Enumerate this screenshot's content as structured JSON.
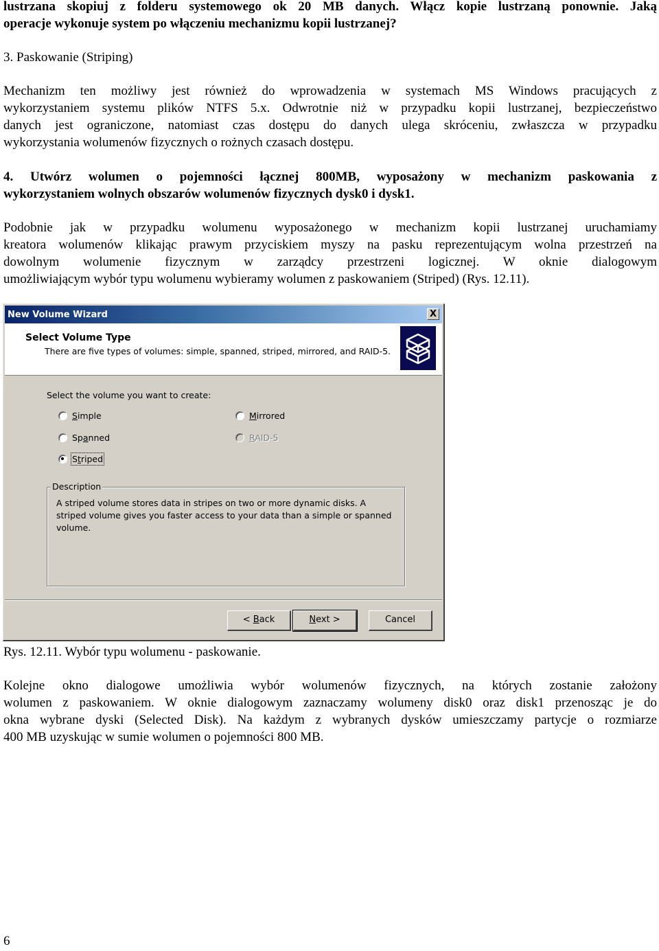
{
  "document": {
    "intro_question": {
      "lines": [
        "lustrzana skopiuj z folderu systemowego ok 20 MB danych. Włącz kopie lustrzaną ponownie. Jaką",
        "operacje wykonuje system po włączeniu mechanizmu kopii lustrzanej?"
      ]
    },
    "section_heading": "3. Paskowanie (Striping)",
    "paragraph_striping": {
      "lines": [
        "Mechanizm ten możliwy jest również do wprowadzenia w systemach MS Windows pracujących z",
        "wykorzystaniem systemu plików NTFS 5.x. Odwrotnie niż w przypadku kopii lustrzanej, bezpieczeństwo",
        "danych jest ograniczone, natomiast czas dostępu do danych ulega skróceniu, zwłaszcza w przypadku",
        "wykorzystania wolumenów fizycznych o rożnych czasach dostępu."
      ]
    },
    "task_4": {
      "lines": [
        "4. Utwórz wolumen o pojemności łącznej 800MB, wyposażony w mechanizm paskowania z",
        "wykorzystaniem wolnych obszarów wolumenów fizycznych dysk0 i dysk1."
      ]
    },
    "paragraph_wizard": {
      "lines": [
        "Podobnie jak w przypadku wolumenu wyposażonego w mechanizm kopii lustrzanej uruchamiamy",
        "kreatora wolumenów klikając prawym przyciskiem myszy na pasku reprezentującym wolna przestrzeń na",
        "dowolnym wolumenie fizycznym w zarządcy przestrzeni logicznej. W oknie dialogowym",
        "umożliwiającym wybór typu wolumenu wybieramy wolumen z paskowaniem (Striped) (Rys. 12.11)."
      ]
    },
    "figure_caption": "Rys. 12.11. Wybór typu wolumenu - paskowanie.",
    "paragraph_next": {
      "lines": [
        "Kolejne okno dialogowe umożliwia wybór wolumenów fizycznych, na których zostanie założony",
        "wolumen z paskowaniem. W oknie dialogowym zaznaczamy wolumeny disk0 oraz disk1 przenosząc je do",
        "okna wybrane dyski (Selected Disk). Na każdym z wybranych dysków umieszczamy partycje o rozmiarze",
        "400 MB uzyskując w sumie wolumen o pojemności 800 MB."
      ]
    },
    "page_number": "6"
  },
  "dialog": {
    "title": "New Volume Wizard",
    "close_label": "X",
    "header_title": "Select Volume Type",
    "header_subtitle": "There are five types of volumes: simple, spanned, striped, mirrored, and RAID-5.",
    "header_icon": "stacked-disks-icon",
    "prompt": "Select the volume you want to create:",
    "options": [
      {
        "label": "Simple",
        "accel": "S",
        "rest": "imple",
        "checked": false,
        "disabled": false
      },
      {
        "label": "Spanned",
        "pre": "Sp",
        "accel": "a",
        "rest": "nned",
        "checked": false,
        "disabled": false
      },
      {
        "label": "Striped",
        "pre": "S",
        "accel": "t",
        "rest": "riped",
        "checked": true,
        "disabled": false
      },
      {
        "label": "Mirrored",
        "accel": "M",
        "rest": "irrored",
        "checked": false,
        "disabled": false
      },
      {
        "label": "RAID-5",
        "accel": "R",
        "rest": "AID-5",
        "checked": false,
        "disabled": true
      }
    ],
    "description_legend": "Description",
    "description_text": "A striped volume stores data in stripes on two or more dynamic disks. A striped volume gives you faster access to your data than a simple or spanned volume.",
    "buttons": {
      "back": {
        "pre": "< ",
        "accel": "B",
        "rest": "ack"
      },
      "next": {
        "accel": "N",
        "rest": "ext >"
      },
      "cancel": "Cancel"
    },
    "colors": {
      "title_start": "#0a246a",
      "title_end": "#a6caf0",
      "face": "#d4d0c8",
      "icon_bg": "#0a0a52"
    }
  }
}
